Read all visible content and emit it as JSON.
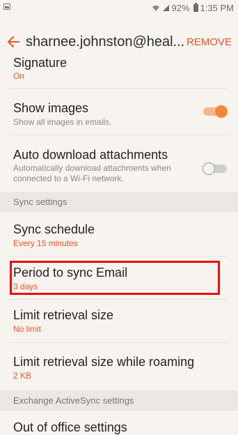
{
  "status_bar": {
    "battery_percent": "92%",
    "time": "1:35 PM"
  },
  "app_bar": {
    "title": "sharnee.johnston@heal...",
    "remove_label": "REMOVE"
  },
  "settings": {
    "signature": {
      "title": "Signature",
      "value": "On"
    },
    "show_images": {
      "title": "Show images",
      "description": "Show all images in emails.",
      "enabled": true
    },
    "auto_download": {
      "title": "Auto download attachments",
      "description_line1": "Automatically download attachments when",
      "description_line2": "connected to a Wi-Fi network.",
      "enabled": false
    },
    "sync_header": "Sync settings",
    "sync_schedule": {
      "title": "Sync schedule",
      "value": "Every 15 minutes"
    },
    "period_to_sync": {
      "title": "Period to sync Email",
      "value": "3 days"
    },
    "limit_retrieval": {
      "title": "Limit retrieval size",
      "value": "No limit"
    },
    "limit_retrieval_roaming": {
      "title": "Limit retrieval size while roaming",
      "value": "2 KB"
    },
    "exchange_header": "Exchange ActiveSync settings",
    "out_of_office": {
      "title": "Out of office settings"
    }
  },
  "colors": {
    "accent": "#e8552a",
    "toggle_on": "#f08a3a",
    "highlight": "#e50f0f",
    "background": "#f7f3ee"
  },
  "icons": [
    "notification-icon",
    "wifi-icon",
    "signal-icon",
    "battery-icon",
    "back-arrow-icon"
  ]
}
